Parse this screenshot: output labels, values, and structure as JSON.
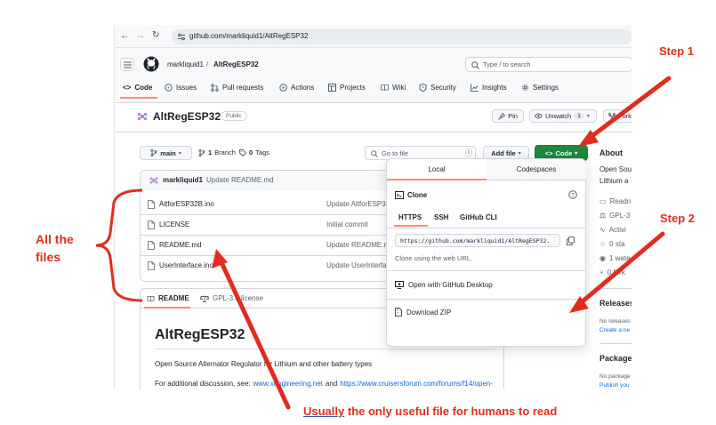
{
  "browser": {
    "url": "github.com/markliquid1/AltRegESP32"
  },
  "header": {
    "owner": "markliquid1",
    "separator": "/",
    "repo": "AltRegESP32",
    "search_placeholder": "Type / to search"
  },
  "nav_tabs": [
    {
      "label": "Code"
    },
    {
      "label": "Issues"
    },
    {
      "label": "Pull requests"
    },
    {
      "label": "Actions"
    },
    {
      "label": "Projects"
    },
    {
      "label": "Wiki"
    },
    {
      "label": "Security"
    },
    {
      "label": "Insights"
    },
    {
      "label": "Settings"
    }
  ],
  "repo": {
    "title": "AltRegESP32",
    "visibility": "Public",
    "pin_label": "Pin",
    "watch_label": "Unwatch",
    "watch_count": "1",
    "fork_label": "Fork"
  },
  "toolbar": {
    "branch": "main",
    "branch_count": "1",
    "branch_label": "Branch",
    "tags_count": "0",
    "tags_label": "Tags",
    "goto_file": "Go to file",
    "goto_key": "t",
    "add_file": "Add file",
    "code": "Code"
  },
  "commit": {
    "author": "markliquid1",
    "message": "Update README.md"
  },
  "files": [
    {
      "name": "AltforESP32B.ino",
      "message": "Update AltforESP32"
    },
    {
      "name": "LICENSE",
      "message": "Initial commit"
    },
    {
      "name": "README.md",
      "message": "Update README.m"
    },
    {
      "name": "UserInterface.ino",
      "message": "Update UserInterfa"
    }
  ],
  "readme_tabs": {
    "readme": "README",
    "license": "GPL-3.0 license"
  },
  "readme": {
    "heading": "AltRegESP32",
    "line1": "Open Source Alternator Regulator for Lithium and other battery types",
    "line2_prefix": "For additional discussion, see:",
    "link1": "www.xengineering.net",
    "line2_and": "and",
    "link2": "https://www.cruisersforum.com/forums/f14/open-"
  },
  "clone_popup": {
    "tab_local": "Local",
    "tab_codespaces": "Codespaces",
    "clone_label": "Clone",
    "proto_https": "HTTPS",
    "proto_ssh": "SSH",
    "proto_cli": "GitHub CLI",
    "url": "https://github.com/markliquid1/AltRegESP32.",
    "hint": "Clone using the web URL.",
    "open_desktop": "Open with GitHub Desktop",
    "download_zip": "Download ZIP"
  },
  "sidebar": {
    "about": "About",
    "about_line1": "Open Sou",
    "about_line2": "Lithium a",
    "readme": "Readn",
    "license": "GPL-3",
    "activity": "Activi",
    "stars": "0 sta",
    "watching": "1 wate",
    "forks": "0 fork",
    "releases": "Releases",
    "no_releases": "No releases",
    "create_release": "Create a ne",
    "packages": "Package",
    "no_packages": "No package",
    "publish": "Publish you"
  },
  "annotations": {
    "step1": "Step 1",
    "step2": "Step 2",
    "all_files_1": "All the",
    "all_files_2": "files",
    "bottom_emph": "Usually",
    "bottom_rest": " the only useful file for humans to read"
  },
  "colors": {
    "annotation_red": "#e02d1f",
    "code_green": "#1f883d",
    "link_blue": "#0969da",
    "tab_underline": "#fd8c73"
  }
}
